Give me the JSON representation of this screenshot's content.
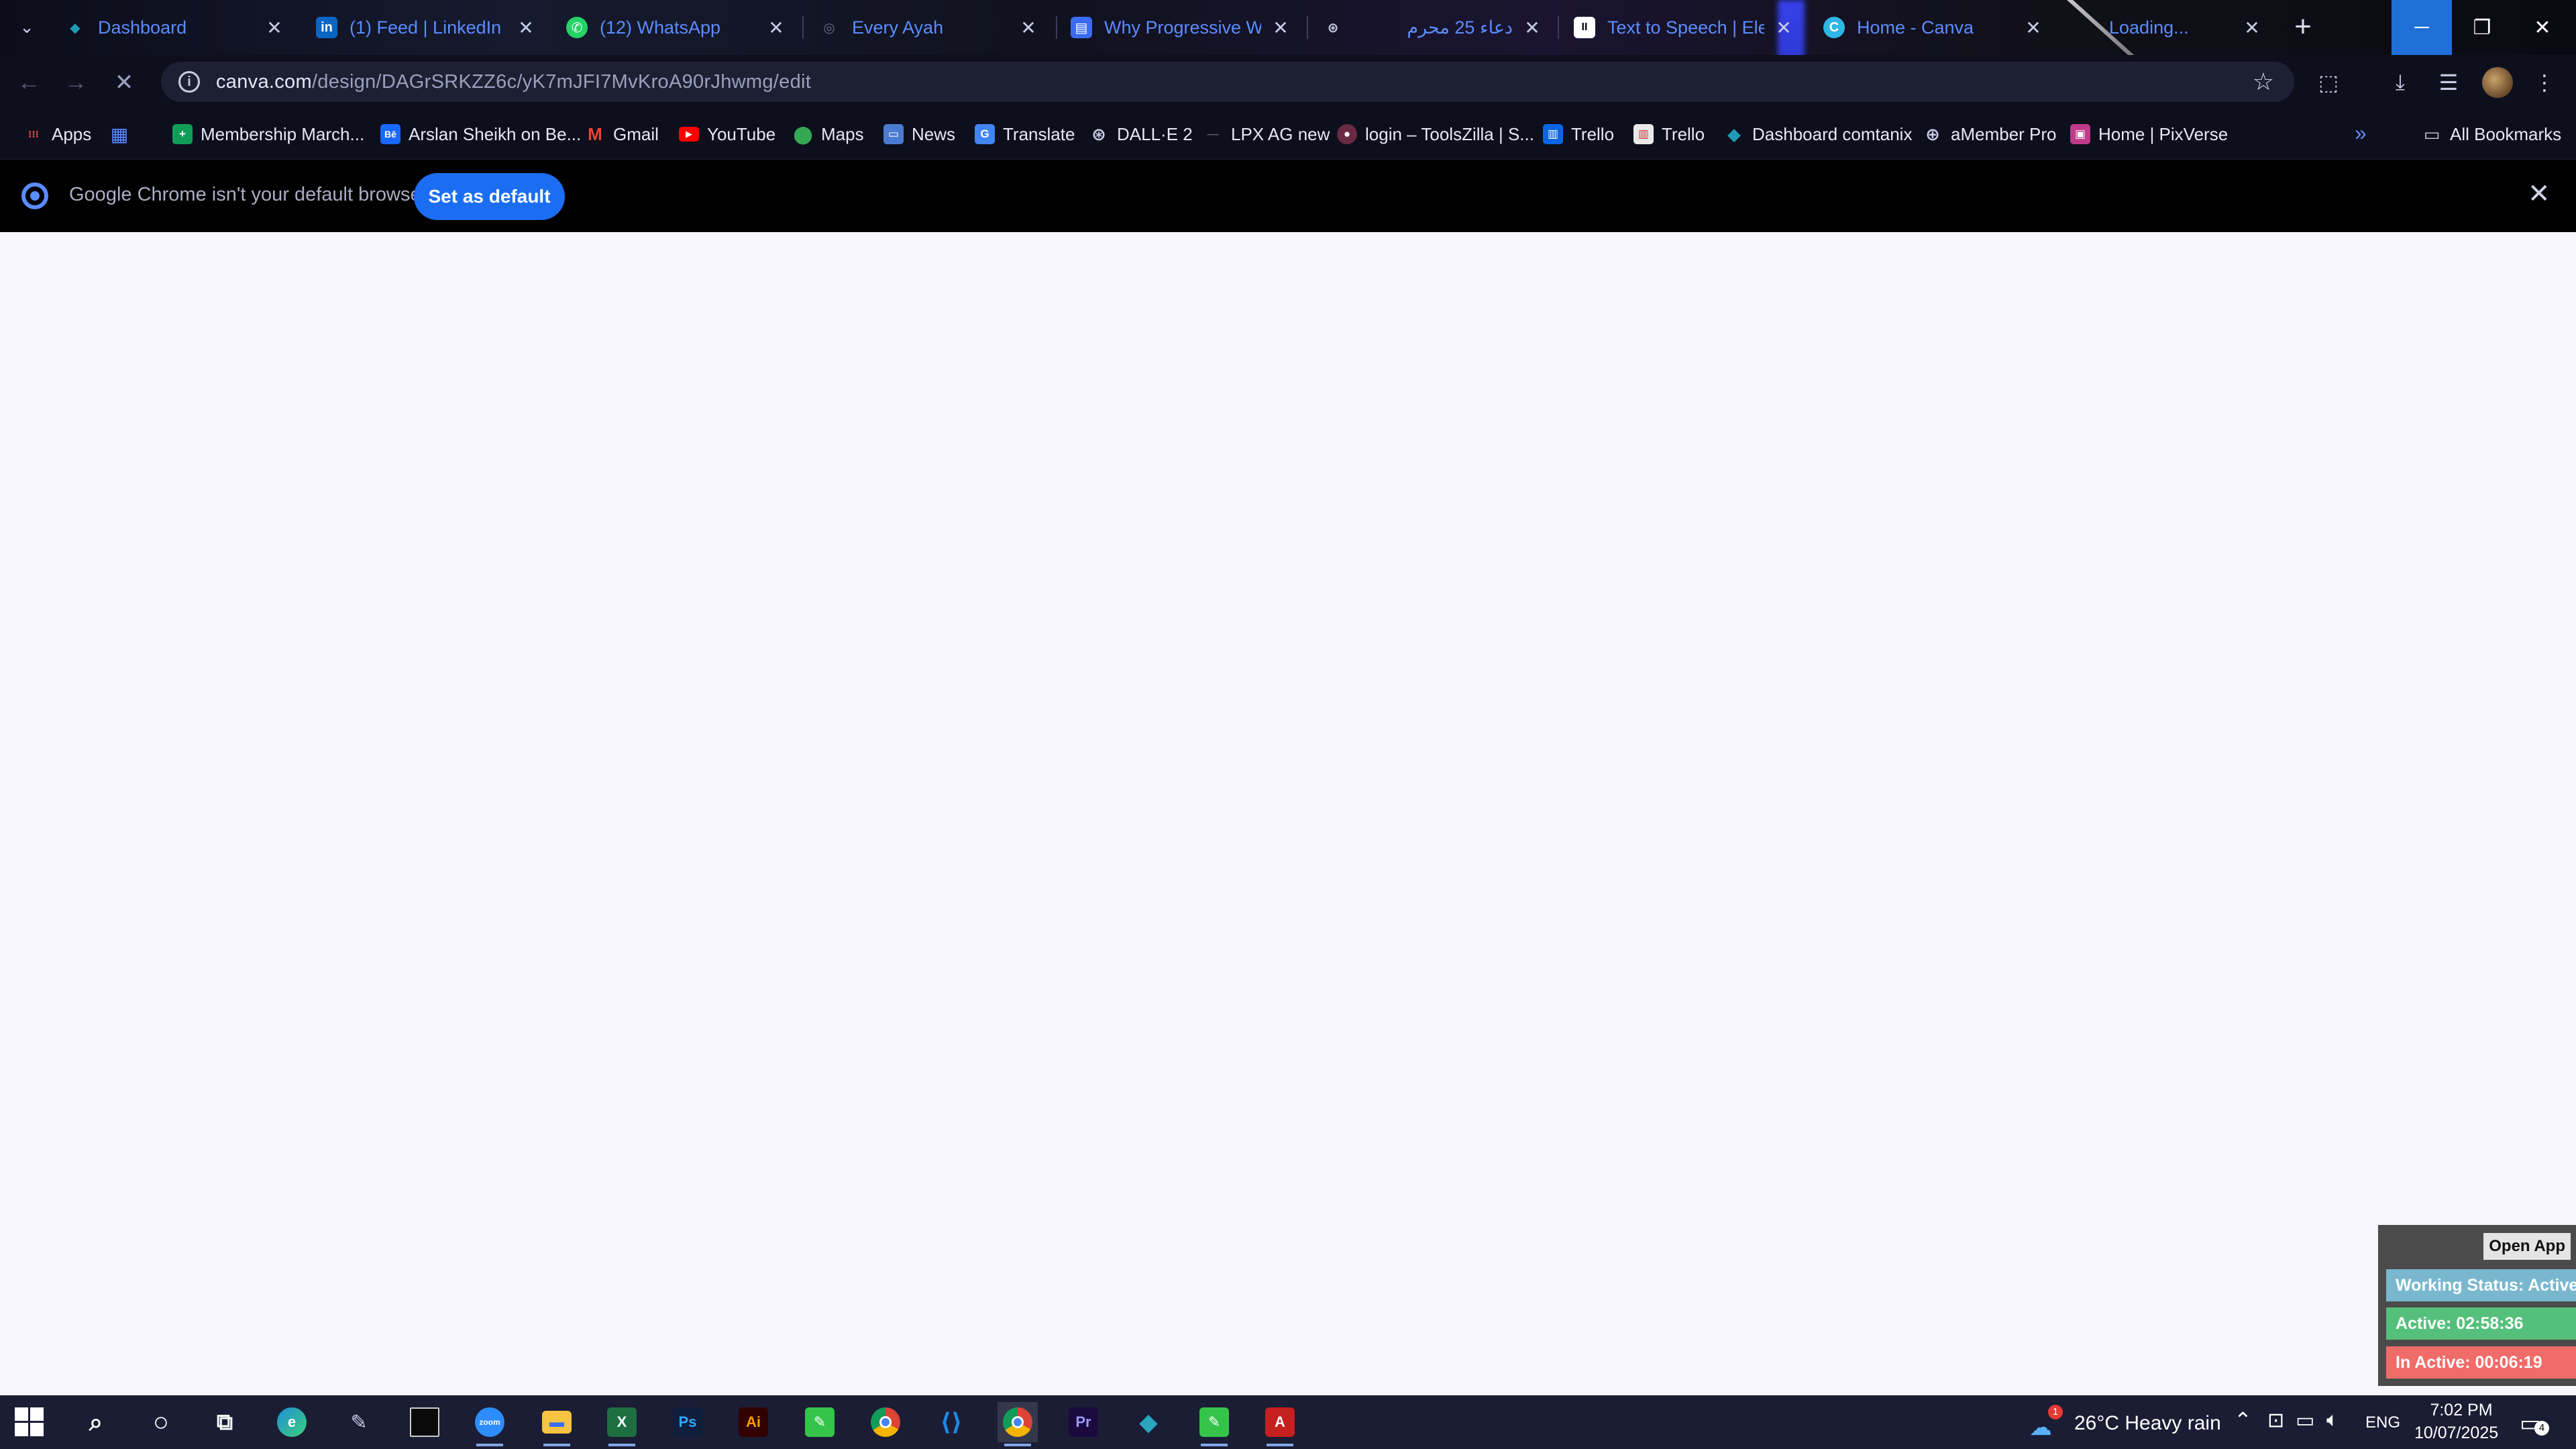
{
  "tabs": [
    {
      "title": "Dashboard",
      "favicon_color": "#1f9bb5",
      "favicon_glyph": "◆"
    },
    {
      "title": "(1) Feed | LinkedIn",
      "favicon_color": "#0a66c2",
      "favicon_glyph": "in"
    },
    {
      "title": "(12) WhatsApp",
      "favicon_color": "#25d366",
      "favicon_glyph": "✆"
    },
    {
      "title": "Every Ayah",
      "favicon_color": "#6a6f85",
      "favicon_glyph": "◎"
    },
    {
      "title": "Why Progressive Web",
      "favicon_color": "#3b6cf0",
      "favicon_glyph": "▤"
    },
    {
      "title": "دعاء 25 محرم",
      "favicon_color": "#1a1a1a",
      "favicon_glyph": "⊛"
    },
    {
      "title": "Text to Speech | Eleve",
      "favicon_color": "#ffffff",
      "favicon_glyph": "II"
    },
    {
      "title": "Home - Canva",
      "favicon_color": "#2fb6e6",
      "favicon_glyph": "C"
    },
    {
      "title": "Loading...",
      "favicon_color": "transparent",
      "favicon_glyph": ""
    }
  ],
  "address": {
    "domain": "canva.com",
    "path": "/design/DAGrSRKZZ6c/yK7mJFI7MvKroA90rJhwmg/edit"
  },
  "bookmarks": [
    {
      "label": "Apps",
      "color": "transparent",
      "glyph": "⋮⋮⋮"
    },
    {
      "label": "",
      "color": "transparent",
      "glyph": "▦"
    },
    {
      "label": "Membership March...",
      "color": "#0f9d58",
      "glyph": "+"
    },
    {
      "label": "Arslan Sheikh on Be...",
      "color": "#1769ff",
      "glyph": "Bē"
    },
    {
      "label": "Gmail",
      "color": "transparent",
      "glyph": "M"
    },
    {
      "label": "YouTube",
      "color": "#ff0000",
      "glyph": "▶"
    },
    {
      "label": "Maps",
      "color": "transparent",
      "glyph": "◉"
    },
    {
      "label": "News",
      "color": "#4a7bd0",
      "glyph": "▭"
    },
    {
      "label": "Translate",
      "color": "#4285f4",
      "glyph": "G"
    },
    {
      "label": "DALL·E 2",
      "color": "transparent",
      "glyph": "⊛"
    },
    {
      "label": "LPX AG new",
      "color": "transparent",
      "glyph": "—"
    },
    {
      "label": "login – ToolsZilla | S...",
      "color": "#6a2a44",
      "glyph": "●"
    },
    {
      "label": "Trello",
      "color": "#0c66e4",
      "glyph": "▥"
    },
    {
      "label": "Trello",
      "color": "#e9e9e9",
      "glyph": "▥"
    },
    {
      "label": "Dashboard comtanix",
      "color": "#1f9bb5",
      "glyph": "◆"
    },
    {
      "label": "aMember Pro",
      "color": "transparent",
      "glyph": "⊕"
    },
    {
      "label": "Home | PixVerse",
      "color": "#c03a8a",
      "glyph": "▣"
    }
  ],
  "all_bookmarks_label": "All Bookmarks",
  "infobar": {
    "message": "Google Chrome isn't your default browser",
    "button_label": "Set as default"
  },
  "tracker": {
    "open_app_label": "Open App",
    "status_label": "Working Status: Active",
    "active_label": "Active: 02:58:36",
    "inactive_label": "In Active: 00:06:19"
  },
  "taskbar": {
    "apps": [
      {
        "name": "search",
        "glyph": "⌕",
        "color": "transparent"
      },
      {
        "name": "cortana",
        "glyph": "○",
        "color": "transparent"
      },
      {
        "name": "task-view",
        "glyph": "⧉",
        "color": "transparent"
      },
      {
        "name": "edge",
        "glyph": "e",
        "color": "#1f8fd8"
      },
      {
        "name": "pen",
        "glyph": "✎",
        "color": "transparent"
      },
      {
        "name": "terminal",
        "glyph": "",
        "color": "#0a0a0a"
      },
      {
        "name": "zoom",
        "glyph": "zoom",
        "color": "#2d8cff"
      },
      {
        "name": "file-explorer",
        "glyph": "▬",
        "color": "#f6c343"
      },
      {
        "name": "excel",
        "glyph": "X",
        "color": "#1d6f42"
      },
      {
        "name": "photoshop",
        "glyph": "Ps",
        "color": "#0f1e3d"
      },
      {
        "name": "illustrator",
        "glyph": "Ai",
        "color": "#330000"
      },
      {
        "name": "app-green",
        "glyph": "✎",
        "color": "#35c44a"
      },
      {
        "name": "chrome",
        "glyph": "◉",
        "color": "#db4437"
      },
      {
        "name": "vscode",
        "glyph": "⟨⟩",
        "color": "#1e88e5"
      },
      {
        "name": "chrome-active",
        "glyph": "◉",
        "color": "#db4437"
      },
      {
        "name": "premiere",
        "glyph": "Pr",
        "color": "#1a0a3d"
      },
      {
        "name": "app-diamond",
        "glyph": "◆",
        "color": "#2aa5c0"
      },
      {
        "name": "app-green-2",
        "glyph": "✎",
        "color": "#35c44a"
      },
      {
        "name": "acrobat",
        "glyph": "A",
        "color": "#c61f1f"
      }
    ],
    "weather": "26°C  Heavy rain",
    "weather_badge": "1",
    "language": "ENG",
    "time": "7:02 PM",
    "date": "10/07/2025",
    "notification_count": "4"
  }
}
